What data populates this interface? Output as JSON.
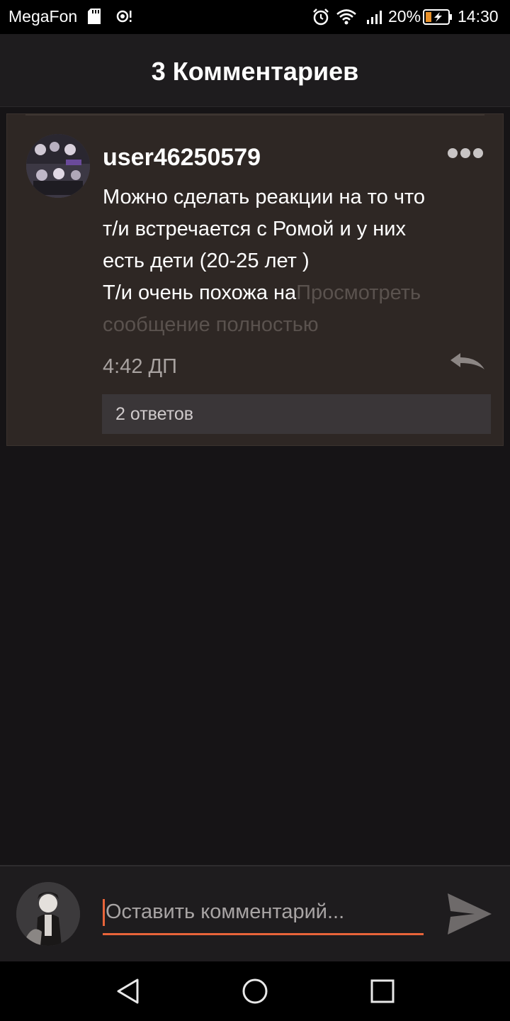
{
  "status_bar": {
    "carrier": "MegaFon",
    "battery_percent": "20%",
    "time": "14:30",
    "icons": [
      "sd-card-icon",
      "hotspot-icon",
      "alarm-icon",
      "wifi-icon",
      "signal-icon",
      "battery-charging-icon"
    ]
  },
  "header": {
    "title": "3 Комментариев"
  },
  "comment": {
    "username": "user46250579",
    "text_lines": [
      "Можно сделать реакции на то что",
      "т/и встречается с Ромой и у них",
      "есть дети (20-25 лет )"
    ],
    "text_last_start": "Т/и очень похожа на",
    "view_full_part1": "Просмотреть",
    "view_full_part2": "сообщение полностью",
    "time": "4:42 ДП",
    "replies_label": "2 ответов"
  },
  "input_bar": {
    "placeholder": "Оставить комментарий..."
  },
  "colors": {
    "background": "#161416",
    "card": "#2e2724",
    "accent": "#e8643a",
    "muted_text": "#a8a2a0"
  }
}
